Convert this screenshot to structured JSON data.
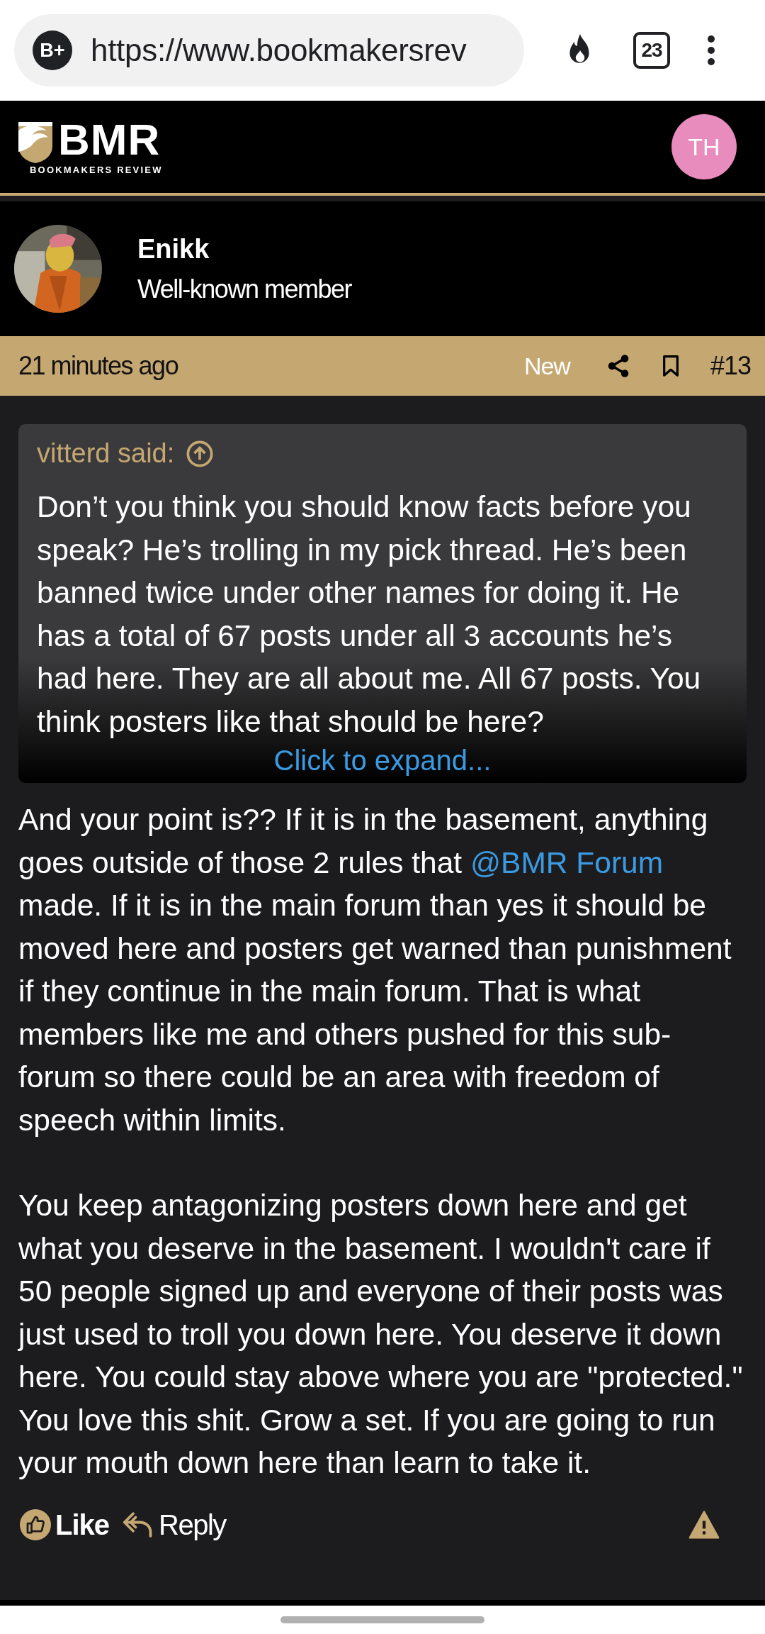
{
  "browser": {
    "site_badge": "B+",
    "url": "https://www.bookmakersrev",
    "tab_count": "23"
  },
  "site_header": {
    "logo_text": "BMR",
    "logo_subtitle": "BOOKMAKERS REVIEW",
    "user_initials": "TH"
  },
  "post": {
    "author": "Enikk",
    "avatar": {
      "kind": "picture"
    },
    "role": "Well-known member",
    "time": "21 minutes ago",
    "new_label": "New",
    "number": "#13",
    "quote": {
      "author": "vitterd said:",
      "text": "Don’t you think you should know facts before you speak? He’s trolling in my pick thread. He’s been banned twice under other names for doing it. He has a total of 67 posts under all 3 accounts he’s had here. They are all about me. All 67 posts. You think posters like that should be here?",
      "expand": "Click to expand..."
    },
    "paragraphs": [
      [
        {
          "kind": "text",
          "text": "And your point is?? If it is in the basement, anything goes outside of those 2 rules that "
        },
        {
          "kind": "mention",
          "text": "@BMR Forum"
        },
        {
          "kind": "text",
          "text": " made. If it is in the main forum than yes it should be moved here and posters get warned than punishment if they continue in the main forum. That is what members like me and others pushed for this sub-forum so there could be an area with freedom of speech within limits."
        }
      ],
      [
        {
          "kind": "text",
          "text": "You keep antagonizing posters down here and get what you deserve in the basement. I wouldn't care if 50 people signed up and everyone of their posts was just used to troll you down here. You deserve it down here. You could stay above where you are \"protected.\" You love this shit. Grow a set. If you are going to run your mouth down here than learn to take it."
        }
      ]
    ],
    "actions": {
      "like": "Like",
      "reply": "Reply"
    }
  }
}
